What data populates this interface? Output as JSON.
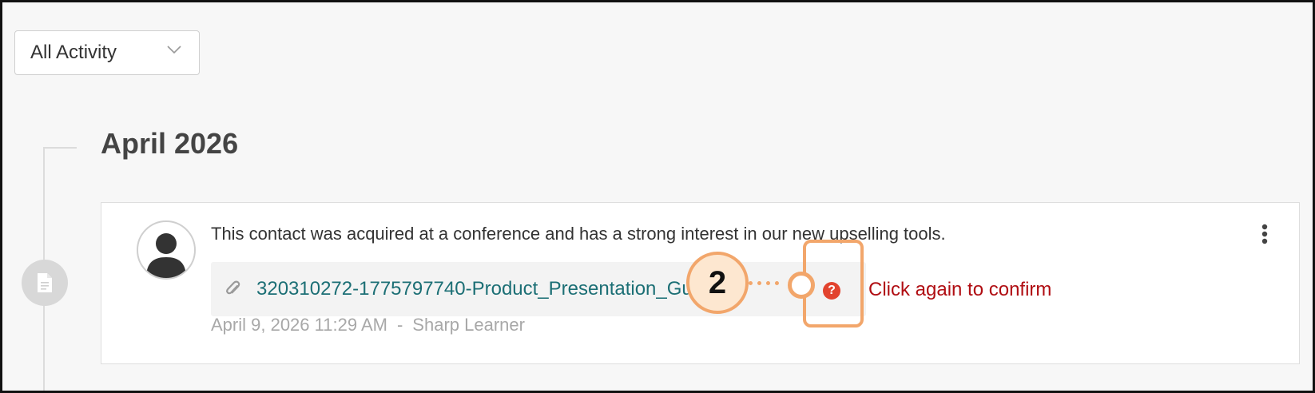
{
  "filter": {
    "label": "All Activity",
    "icon": "chevron-down-icon"
  },
  "timeline": {
    "month": "April 2026",
    "node_icon": "document-icon"
  },
  "activity": {
    "note": "This contact was acquired at a conference and has a strong interest in our new upselling tools.",
    "attachment": {
      "icon": "paperclip-icon",
      "filename": "320310272-1775797740-Product_Presentation_Guide.p"
    },
    "confirm": {
      "icon": "question-icon",
      "text": "Click again to confirm"
    },
    "timestamp": "April 9, 2026 11:29 AM",
    "separator": "-",
    "author": "Sharp Learner",
    "menu_icon": "more-vertical-icon"
  },
  "annotation": {
    "step": "2",
    "accent": "#f2a66b"
  },
  "colors": {
    "link": "#1c6f75",
    "confirm_text": "#b00d12",
    "confirm_icon": "#e2432e"
  }
}
